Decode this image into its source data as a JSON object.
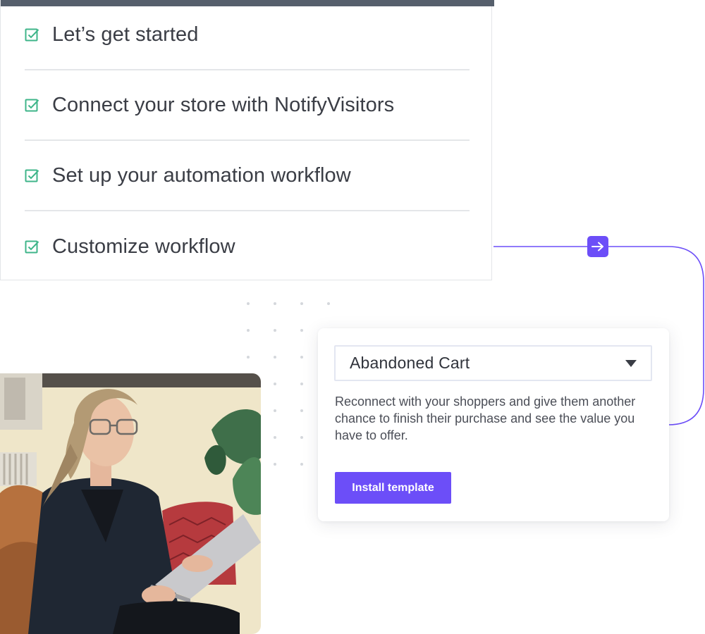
{
  "checklist": {
    "steps": [
      {
        "label": "Let’s get started",
        "checked": true
      },
      {
        "label": "Connect your store with NotifyVisitors",
        "checked": true
      },
      {
        "label": "Set up your automation workflow",
        "checked": true
      },
      {
        "label": "Customize workflow",
        "checked": true
      }
    ]
  },
  "template": {
    "selected": "Abandoned Cart",
    "description": "Reconnect with your shoppers and give them another chance to finish their purchase and see the value you have to offer.",
    "install_label": "Install template"
  },
  "icons": {
    "check": "checkbox-checked-icon",
    "arrow": "arrow-right-icon",
    "caret": "caret-down-icon"
  },
  "colors": {
    "accent": "#6c4ef8",
    "check": "#3fb58a",
    "topbar": "#565f6c",
    "text": "#3a3d45"
  }
}
